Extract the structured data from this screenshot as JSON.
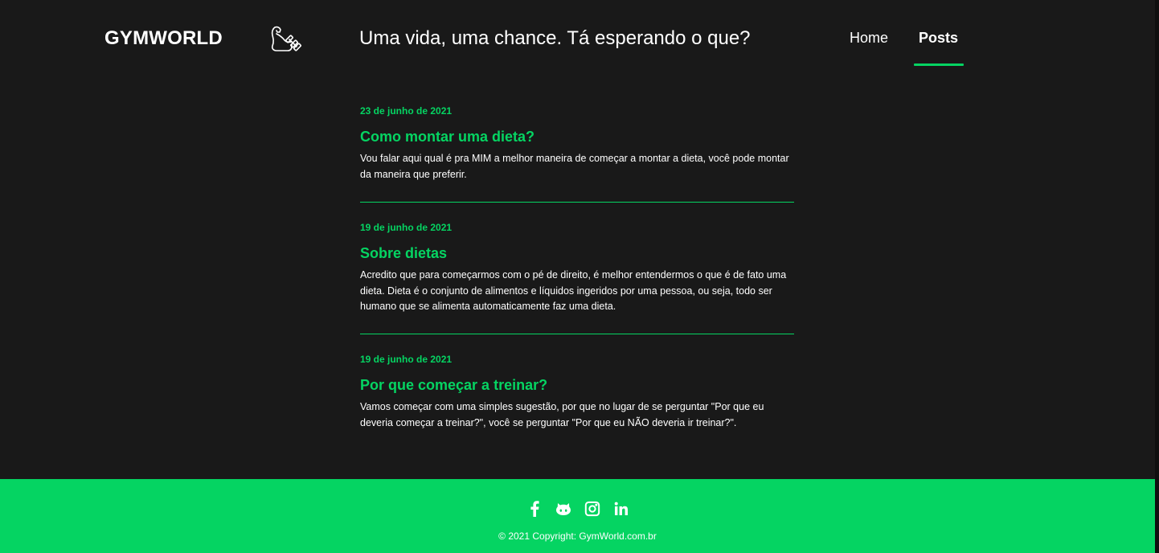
{
  "header": {
    "logo": "GYMWORLD",
    "logo_icon": "flexed-arm-dumbbell-icon",
    "tagline": "Uma vida, uma chance. Tá esperando o que?",
    "nav": {
      "home": "Home",
      "posts": "Posts",
      "active": "Posts"
    }
  },
  "posts": [
    {
      "date": "23 de junho de 2021",
      "title": "Como montar uma dieta?",
      "excerpt": "Vou falar aqui qual é pra MIM a melhor maneira de começar a montar a dieta, você pode montar da maneira que preferir."
    },
    {
      "date": "19 de junho de 2021",
      "title": "Sobre dietas",
      "excerpt": "Acredito que para começarmos com o pé de direito, é melhor entendermos o que é de fato uma dieta. Dieta é o conjunto de alimentos e líquidos ingeridos por uma pessoa, ou seja, todo ser humano que se alimenta automaticamente faz uma dieta."
    },
    {
      "date": "19 de junho de 2021",
      "title": "Por que começar a treinar?",
      "excerpt": "Vamos começar com uma simples sugestão, por que no lugar de se perguntar \"Por que eu deveria começar a treinar?\", você se perguntar \"Por que eu NÃO deveria ir treinar?\"."
    }
  ],
  "footer": {
    "socials": [
      "facebook-icon",
      "github-icon",
      "instagram-icon",
      "linkedin-icon"
    ],
    "copyright": "© 2021 Copyright: GymWorld.com.br"
  },
  "colors": {
    "background": "#191919",
    "accent": "#05d462",
    "text": "#ffffff"
  }
}
